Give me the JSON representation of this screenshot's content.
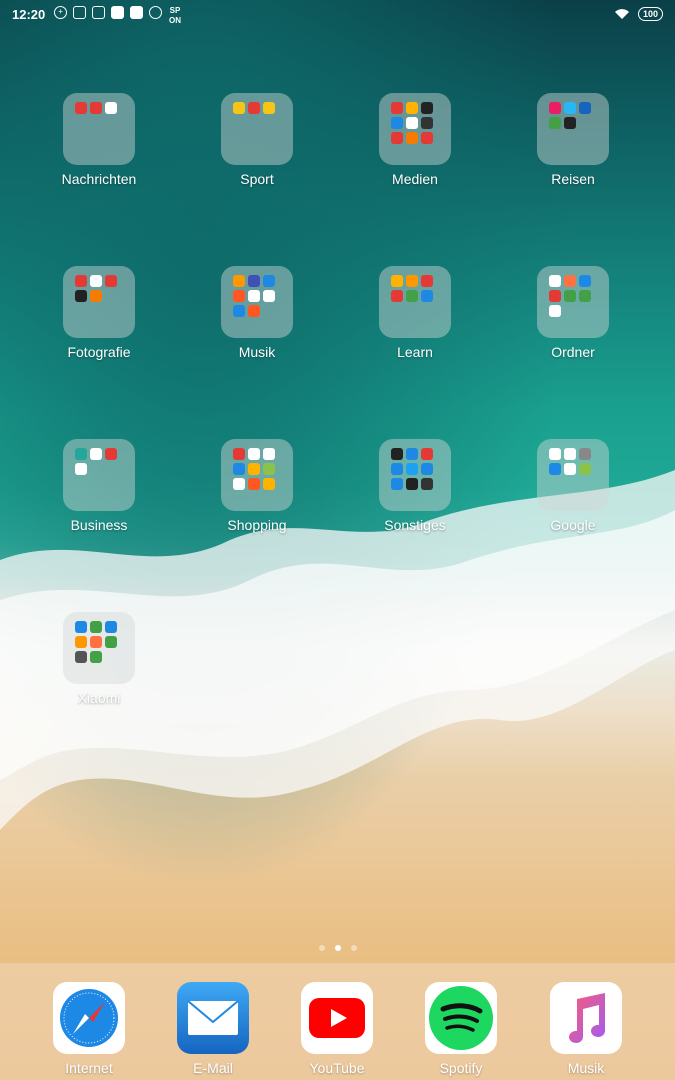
{
  "status": {
    "time": "12:20",
    "battery": "100",
    "spon": "SP ON"
  },
  "folders": [
    {
      "label": "Nachrichten",
      "icons": [
        "#e53935",
        "#e53935",
        "#ffffff"
      ]
    },
    {
      "label": "Sport",
      "icons": [
        "#f5c518",
        "#e53935",
        "#f5c518"
      ]
    },
    {
      "label": "Medien",
      "icons": [
        "#e53935",
        "#ffb300",
        "#222222",
        "#1e88e5",
        "#ffffff",
        "#333333",
        "#e53935",
        "#f57c00",
        "#e53935"
      ]
    },
    {
      "label": "Reisen",
      "icons": [
        "#e91e63",
        "#29b6f6",
        "#1565c0",
        "#43a047",
        "#222222"
      ]
    },
    {
      "label": "Fotografie",
      "icons": [
        "#e53935",
        "#ffffff",
        "#e53935",
        "#222222",
        "#f57c00"
      ]
    },
    {
      "label": "Musik",
      "icons": [
        "#ff9800",
        "#3f51b5",
        "#1e88e5",
        "#ff5722",
        "#ffffff",
        "#ffffff",
        "#1e88e5",
        "#ff5722"
      ]
    },
    {
      "label": "Learn",
      "icons": [
        "#ffb300",
        "#ff9800",
        "#e53935",
        "#e53935",
        "#43a047",
        "#1e88e5"
      ]
    },
    {
      "label": "Ordner",
      "icons": [
        "#ffffff",
        "#ff7043",
        "#1e88e5",
        "#e53935",
        "#43a047",
        "#43a047",
        "#ffffff"
      ]
    },
    {
      "label": "Business",
      "icons": [
        "#26a69a",
        "#ffffff",
        "#e53935",
        "#ffffff"
      ]
    },
    {
      "label": "Shopping",
      "icons": [
        "#e53935",
        "#ffffff",
        "#ffffff",
        "#1e88e5",
        "#ffb300",
        "#8bc34a",
        "#ffffff",
        "#ff5722",
        "#ffb300",
        "#8bc34a",
        "#222222",
        "#ffffff",
        "#e53935",
        "#ffffff",
        "#43a047",
        "#ffffff",
        "#ffffff",
        "#e53935",
        "#1e88e5",
        "#1e88e5",
        "#ffffff",
        "#ffffff",
        "#e53935",
        "#ff5722"
      ]
    },
    {
      "label": "Sonstiges",
      "icons": [
        "#222222",
        "#1e88e5",
        "#e53935",
        "#1e88e5",
        "#1da1f2",
        "#1e88e5",
        "#1e88e5",
        "#222222",
        "#333333"
      ]
    },
    {
      "label": "Google",
      "icons": [
        "#ffffff",
        "#ffffff",
        "#888888",
        "#1e88e5",
        "#ffffff",
        "#8bc34a"
      ]
    },
    {
      "label": "Xiaomi",
      "icons": [
        "#1e88e5",
        "#43a047",
        "#1e88e5",
        "#ff9800",
        "#ff7043",
        "#43a047",
        "#555555",
        "#43a047"
      ]
    }
  ],
  "dock": [
    {
      "label": "Internet",
      "icon": "safari-compass-icon"
    },
    {
      "label": "E-Mail",
      "icon": "mail-envelope-icon"
    },
    {
      "label": "YouTube",
      "icon": "youtube-play-icon"
    },
    {
      "label": "Spotify",
      "icon": "spotify-icon"
    },
    {
      "label": "Musik",
      "icon": "music-note-icon"
    }
  ],
  "pages": {
    "count": 3,
    "active": 2
  }
}
